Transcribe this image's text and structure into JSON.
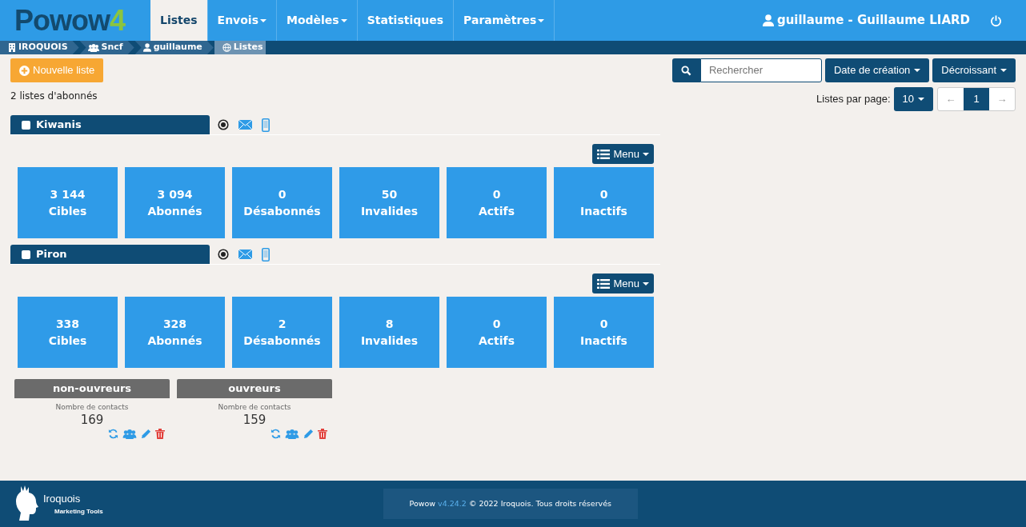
{
  "logo": {
    "text": "Powow",
    "suffix": "4"
  },
  "nav": [
    {
      "label": "Listes",
      "dropdown": false,
      "selected": true
    },
    {
      "label": "Envois",
      "dropdown": true,
      "selected": false
    },
    {
      "label": "Modèles",
      "dropdown": true,
      "selected": false
    },
    {
      "label": "Statistiques",
      "dropdown": false,
      "selected": false
    },
    {
      "label": "Paramètres",
      "dropdown": true,
      "selected": false
    }
  ],
  "user": "guillaume - Guillaume LIARD",
  "breadcrumb": [
    {
      "label": "IROQUOIS",
      "kind": "building"
    },
    {
      "label": "Sncf",
      "kind": "group"
    },
    {
      "label": "guillaume",
      "kind": "user"
    },
    {
      "label": "Listes",
      "kind": "globe"
    }
  ],
  "new_list_button": "Nouvelle liste",
  "count": "2 listes d'abonnés",
  "search": {
    "placeholder": "Rechercher"
  },
  "sort_buttons": [
    "Date de création",
    "Décroissant"
  ],
  "per_page_label": "Listes par page:",
  "per_page": "10",
  "pagination": {
    "prev": "←",
    "pages": [
      {
        "label": "1",
        "selected": true
      }
    ],
    "next": "→"
  },
  "lists": [
    {
      "name": "Kiwanis",
      "checked": false,
      "menu": "Menu",
      "stats": [
        {
          "value": "3 144",
          "label": "Cibles"
        },
        {
          "value": "3 094",
          "label": "Abonnés"
        },
        {
          "value": "0",
          "label": "Désabonnés"
        },
        {
          "value": "50",
          "label": "Invalides"
        },
        {
          "value": "0",
          "label": "Actifs"
        },
        {
          "value": "0",
          "label": "Inactifs"
        }
      ]
    },
    {
      "name": "Piron",
      "checked": false,
      "menu": "Menu",
      "stats": [
        {
          "value": "338",
          "label": "Cibles"
        },
        {
          "value": "328",
          "label": "Abonnés"
        },
        {
          "value": "2",
          "label": "Désabonnés"
        },
        {
          "value": "8",
          "label": "Invalides"
        },
        {
          "value": "0",
          "label": "Actifs"
        },
        {
          "value": "0",
          "label": "Inactifs"
        }
      ],
      "segments": [
        {
          "name": "non-ouvreurs",
          "caption": "Nombre de contacts",
          "count": "169"
        },
        {
          "name": "ouvreurs",
          "caption": "Nombre de contacts",
          "count": "159"
        }
      ]
    }
  ],
  "footer": {
    "brand": "Iroquois",
    "tagline": "Marketing Tools",
    "product": "Powow",
    "version": "v4.24.2",
    "copyright": "© 2022 Iroquois. Tous droits réservés"
  }
}
